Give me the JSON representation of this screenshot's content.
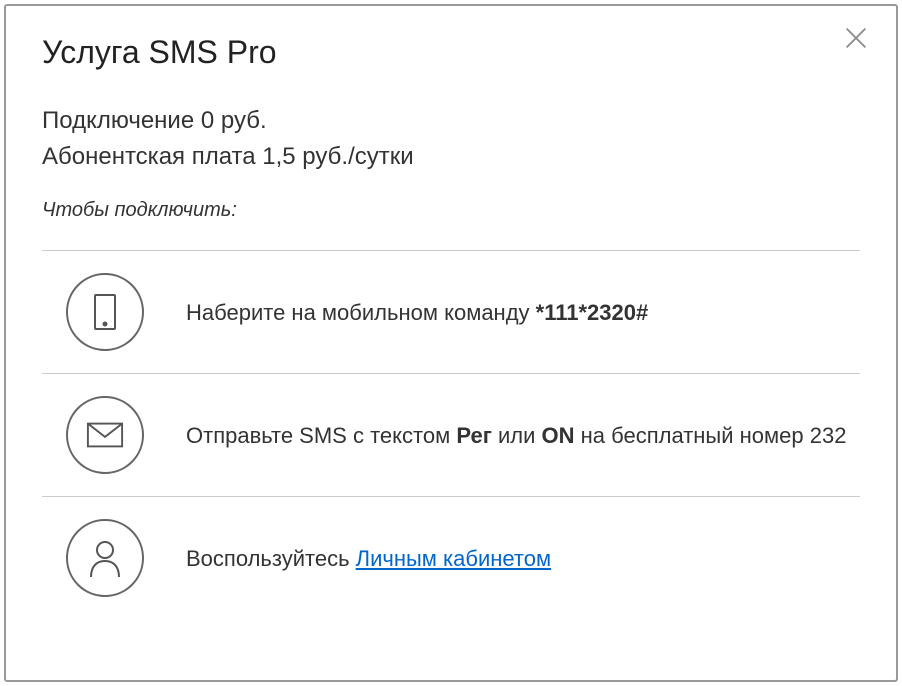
{
  "title": "Услуга SMS Pro",
  "pricing": {
    "connection": "Подключение 0 руб.",
    "fee": "Абонентская плата 1,5 руб./сутки"
  },
  "instructions_label": "Чтобы подключить:",
  "options": {
    "dial": {
      "text_prefix": "Наберите на мобильном команду ",
      "code": "*111*2320#"
    },
    "sms": {
      "text_prefix": "Отправьте SMS с текстом ",
      "keyword1": "Рег",
      "middle": " или ",
      "keyword2": "ON",
      "text_suffix": " на бесплатный номер 232"
    },
    "account": {
      "text_prefix": "Воспользуйтесь ",
      "link_text": "Личным кабинетом"
    }
  }
}
